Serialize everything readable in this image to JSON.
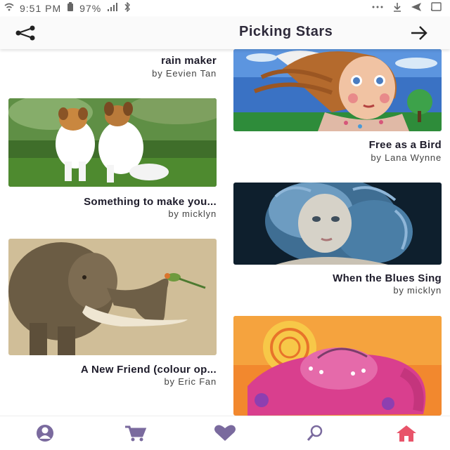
{
  "status_bar": {
    "time": "9:51 PM",
    "battery": "97%",
    "icons": [
      "overflow-dots-icon",
      "download-icon",
      "send-icon",
      "cast-icon"
    ]
  },
  "app_bar": {
    "title": "Picking Stars",
    "icons": [
      "share-icon",
      "back-arrow-icon"
    ]
  },
  "cards": [
    {
      "title": "rain maker",
      "author": "by Eevien Tan"
    },
    {
      "title": "Free as a Bird",
      "author": "by Lana Wynne"
    },
    {
      "title": "Something to make you...",
      "author": "by micklyn"
    },
    {
      "title": "When the Blues Sing",
      "author": "by micklyn"
    },
    {
      "title": "A New Friend (colour op...",
      "author": "by Eric Fan"
    }
  ],
  "bottom_nav": {
    "items": [
      "profile-icon",
      "cart-icon",
      "heart-icon",
      "search-icon",
      "home-icon"
    ],
    "active": "home-icon",
    "colors": {
      "active": "#e8546a",
      "inactive": "#7a6a9e"
    }
  }
}
